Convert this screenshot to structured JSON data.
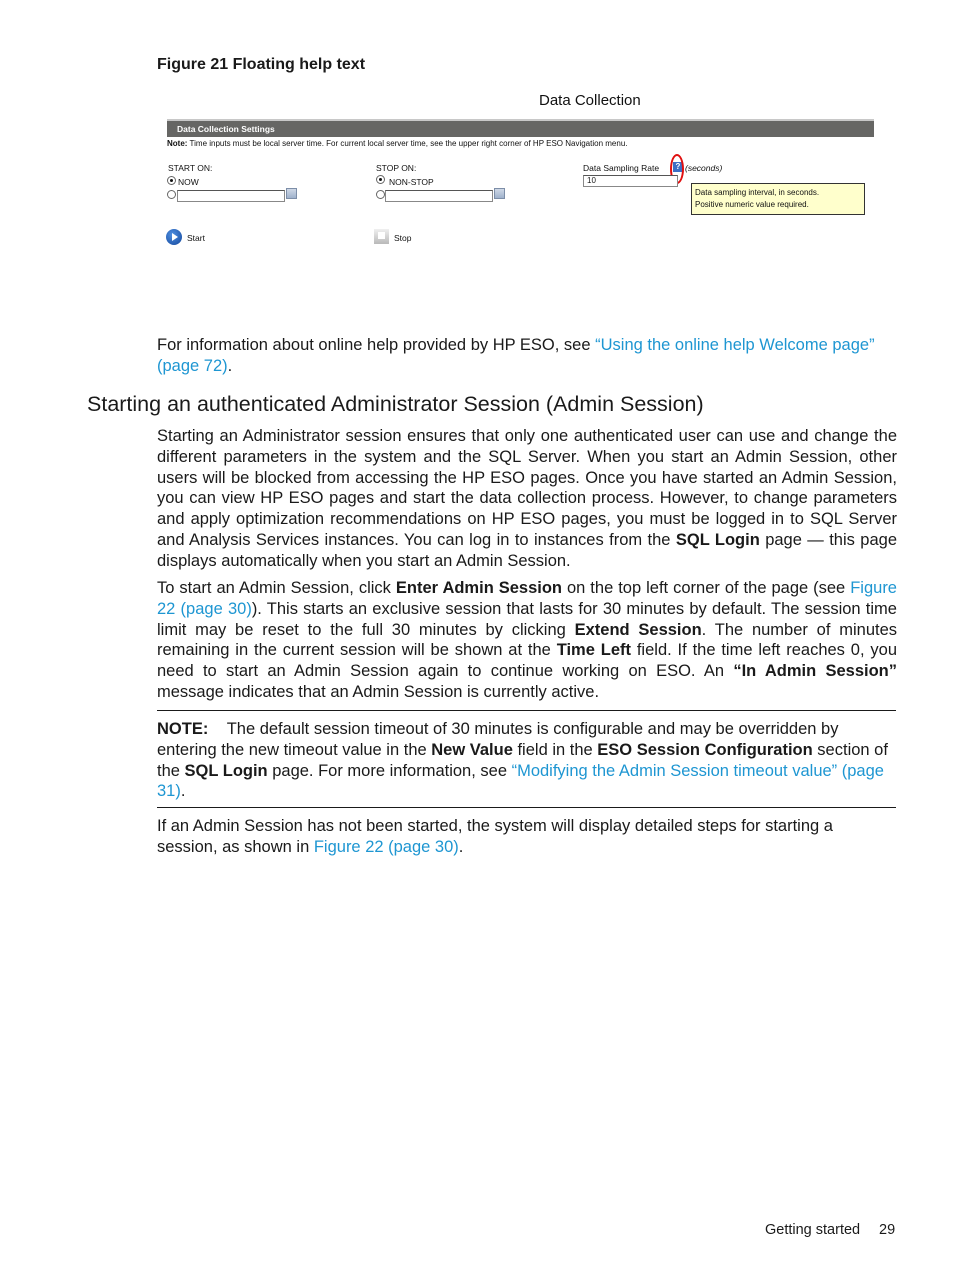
{
  "figure": {
    "caption": "Figure 21 Floating help text",
    "screenshot": {
      "title": "Data Collection",
      "section_bar": "Data Collection Settings",
      "note_label": "Note:",
      "note_text": " Time inputs must be local server time. For current local server time, see the upper right corner of HP ESO Navigation menu.",
      "start_on": {
        "label": "START ON:",
        "option_now": "NOW",
        "date_value": ""
      },
      "stop_on": {
        "label": "STOP ON:",
        "option_nonstop": "NON-STOP",
        "date_value": ""
      },
      "sampling": {
        "label": "Data Sampling Rate",
        "help_glyph": "?",
        "unit": "(seconds)",
        "value": "10"
      },
      "tooltip": {
        "line1": "Data sampling interval, in seconds.",
        "line2": "Positive numeric value required."
      },
      "start_button": "Start",
      "stop_button": "Stop"
    }
  },
  "intro": {
    "text": "For information about online help provided by HP ESO, see ",
    "link": "“Using the online help Welcome page” (page 72)",
    "end": "."
  },
  "section": {
    "heading": "Starting an authenticated Administrator Session (Admin Session)",
    "p1": {
      "a": "Starting an Administrator session ensures that only one authenticated user can use and change the different parameters in the system and the SQL Server. When you start an Admin Session, other users will be blocked from accessing the HP ESO pages. Once you have started an Admin Session, you can view HP ESO pages and start the data collection process. However, to change parameters and apply optimization recommendations on HP ESO pages, you must be logged in to SQL Server and Analysis Services instances. You can log in to instances from the ",
      "b1": "SQL Login",
      "c": " page — this page displays automatically when you start an Admin Session."
    },
    "p2": {
      "a": "To start an Admin Session, click ",
      "b1": "Enter Admin Session",
      "c": " on the top left corner of the page (see ",
      "link": "Figure 22 (page 30)",
      "d": "). This starts an exclusive session that lasts for 30 minutes by default. The session time limit may be reset to the full 30 minutes by clicking ",
      "b2": "Extend Session",
      "e": ". The number of minutes remaining in the current session will be shown at the ",
      "b3": "Time Left",
      "f": " field. If the time left reaches 0, you need to start an Admin Session again to continue working on ESO. An ",
      "b4": "“In Admin Session”",
      "g": " message indicates that an Admin Session is currently active."
    },
    "note": {
      "label": "NOTE:",
      "a": "The default session timeout of 30 minutes is configurable and may be overridden by entering the new timeout value in the ",
      "b1": "New Value",
      "c": " field in the ",
      "b2": "ESO Session Configuration",
      "d": " section of the ",
      "b3": "SQL Login",
      "e": " page. For more information, see ",
      "link": "“Modifying the Admin Session timeout value” (page 31)",
      "f": "."
    },
    "p3": {
      "a": "If an Admin Session has not been started, the system will display detailed steps for starting a session, as shown in ",
      "link": "Figure 22 (page 30)",
      "b": "."
    }
  },
  "footer": {
    "section": "Getting started",
    "page": "29"
  }
}
